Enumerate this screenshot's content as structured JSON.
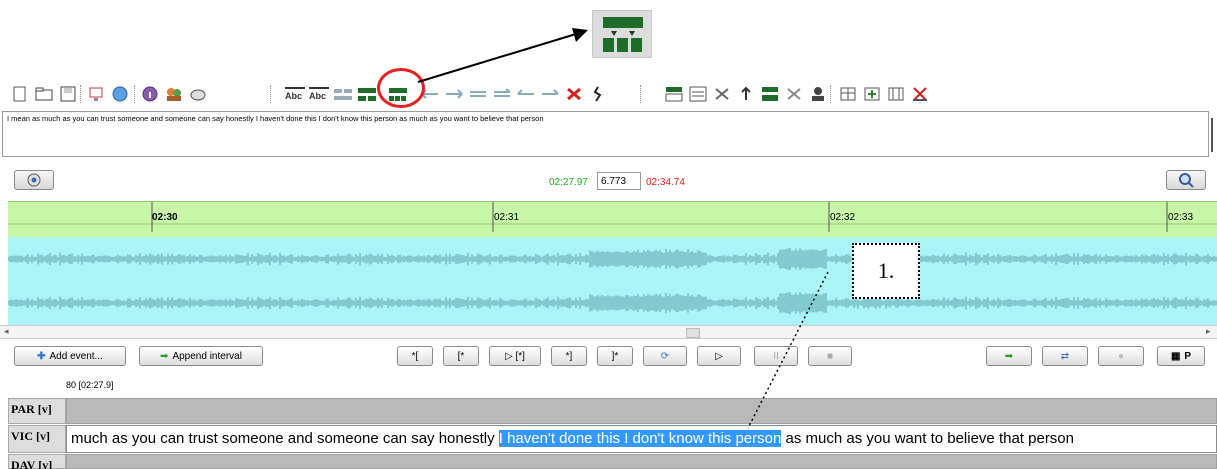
{
  "callout": {
    "icon": "split-tier-icon",
    "note_label": "1."
  },
  "toolbar": {
    "items": [
      "new-file-icon",
      "open-folder-icon",
      "save-icon",
      "monitor-icon",
      "globe-icon",
      "info-icon",
      "speakers-icon",
      "search-replace-icon",
      "abc-left-icon",
      "abc-right-icon",
      "merge-icon",
      "split-active-icon",
      "split-three-icon",
      "move-left-icon",
      "move-right-icon",
      "jump-right-icon",
      "align-left-icon",
      "align-right-icon",
      "delete-event-icon",
      "squiggle-icon",
      "tier-add-icon",
      "tier-edit-icon",
      "tier-remove-icon",
      "tier-up-icon",
      "tier-down-icon",
      "tier-close-icon",
      "person-icon",
      "table-icon",
      "add-column-icon",
      "columns-icon",
      "clear-icon"
    ]
  },
  "transcript": {
    "text": "I mean as much as you can trust someone and someone can say honestly I haven't done this I don't know this person as much as you want to believe that person"
  },
  "times": {
    "start": "02:27.97",
    "duration": "6.773",
    "end": "02:34.74"
  },
  "ruler": {
    "labels": [
      "02:30",
      "02:31",
      "02:32",
      "02:33"
    ]
  },
  "controls": {
    "add_event": "Add event...",
    "append_interval": "Append interval",
    "b1": "*[",
    "b2": "[*",
    "b3": "▷ [*]",
    "b4": "*]",
    "b5": "]*",
    "play": "▷",
    "pause": "II",
    "stop": "■",
    "p_label": "P"
  },
  "tiers": {
    "header": "80 [02:27.9]",
    "par": "PAR [v]",
    "vic": "VIC [v]",
    "dav": "DAV [v]",
    "vic_before": "much as you can trust someone and someone can say honestly ",
    "vic_selected": "I haven't done this I don't know this person",
    "vic_after": " as much as you want to believe that person"
  },
  "colors": {
    "green_time": "#22b022",
    "red_time": "#e02020",
    "ruler": "#c8f5a8",
    "wave": "#aaf3f7",
    "highlight": "#3399ff"
  }
}
